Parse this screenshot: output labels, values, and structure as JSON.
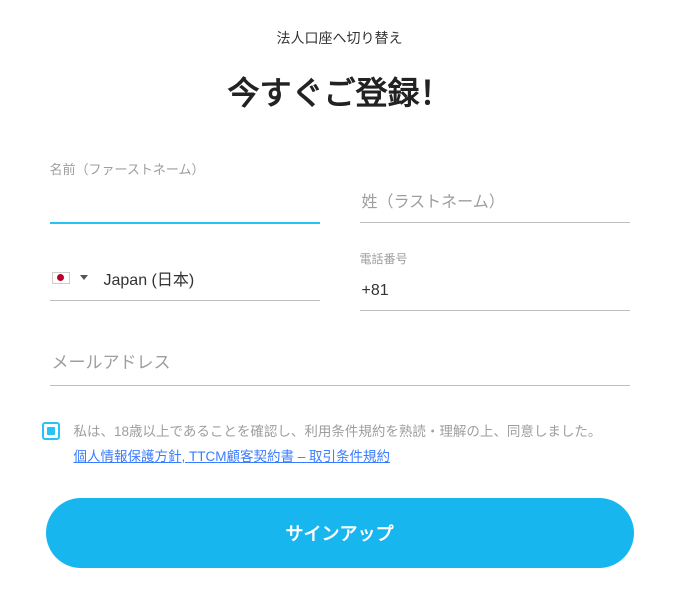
{
  "header": {
    "switch_link": "法人口座へ切り替え",
    "title": "今すぐご登録！"
  },
  "fields": {
    "first_name": {
      "label": "名前（ファーストネーム）",
      "value": ""
    },
    "last_name": {
      "placeholder": "姓（ラストネーム）",
      "value": ""
    },
    "country": {
      "name": "Japan (日本)"
    },
    "phone": {
      "label": "電話番号",
      "value": "+81"
    },
    "email": {
      "placeholder": "メールアドレス",
      "value": ""
    }
  },
  "consent": {
    "checked": true,
    "text_before_link": "私は、18歳以上であることを確認し、利用条件規約を熟読・理解の上、同意しました。",
    "link_text": "個人情報保護方針, TTCM顧客契約書 – 取引条件規約"
  },
  "submit": {
    "label": "サインアップ"
  }
}
